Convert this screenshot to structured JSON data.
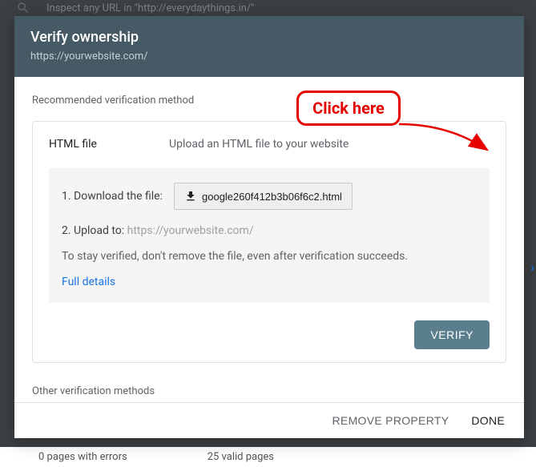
{
  "backdrop": {
    "search_placeholder": "Inspect any URL in \"http://everydaythings.in/\"",
    "bottom_left": "0 pages with errors",
    "bottom_right": "25 valid pages"
  },
  "dialog": {
    "title": "Verify ownership",
    "subtitle": "https://yourwebsite.com/"
  },
  "recommended_label": "Recommended verification method",
  "method": {
    "name": "HTML file",
    "desc": "Upload an HTML file to your website",
    "step1_label": "1. Download the file:",
    "download_filename": "google260f412b3b06f6c2.html",
    "step2_prefix": "2. Upload to: ",
    "step2_url": "https://yourwebsite.com/",
    "stay_text": "To stay verified, don't remove the file, even after verification succeeds.",
    "full_details": "Full details",
    "verify": "VERIFY"
  },
  "other_label": "Other verification methods",
  "footer": {
    "remove": "REMOVE PROPERTY",
    "done": "DONE"
  },
  "annotation": {
    "label": "Click here"
  }
}
